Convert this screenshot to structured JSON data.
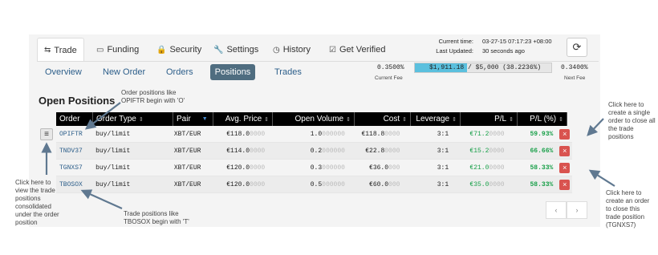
{
  "tabs": [
    {
      "icon": "⇆",
      "label": "Trade"
    },
    {
      "icon": "▭",
      "label": "Funding"
    },
    {
      "icon": "🔒",
      "label": "Security"
    },
    {
      "icon": "🔧",
      "label": "Settings"
    },
    {
      "icon": "◷",
      "label": "History"
    },
    {
      "icon": "☑",
      "label": "Get Verified"
    }
  ],
  "meta": {
    "current_time_label": "Current time:",
    "current_time": "03-27-15 07:17:23 +08:00",
    "last_updated_label": "Last Updated:",
    "last_updated": "30 seconds ago"
  },
  "subnav": [
    "Overview",
    "New Order",
    "Orders",
    "Positions",
    "Trades"
  ],
  "fees": {
    "current_fee": "0.3500%",
    "current_fee_label": "Current Fee",
    "volume": "$1,911.18",
    "volume_rest": " / $5,000 (38.2236%)",
    "progress_pct": 38.2236,
    "next_fee": "0.3400%",
    "next_fee_label": "Next Fee"
  },
  "title": "Open Positions",
  "columns": [
    "Order",
    "Order Type",
    "Pair",
    "Avg. Price",
    "Open Volume",
    "Cost",
    "Leverage",
    "P/L",
    "P/L (%)"
  ],
  "rows": [
    {
      "order": "OPIFTR",
      "type": "buy/limit",
      "pair": "XBT/EUR",
      "price": "€118.0",
      "price_dim": "0000",
      "vol": "1.0",
      "vol_dim": "000000",
      "cost": "€118.8",
      "cost_dim": "0000",
      "lev": "3:1",
      "pl": "€71.2",
      "pl_dim": "0000",
      "plpct": "59.93%"
    },
    {
      "order": "TNDV37",
      "type": "buy/limit",
      "pair": "XBT/EUR",
      "price": "€114.0",
      "price_dim": "0000",
      "vol": "0.2",
      "vol_dim": "000000",
      "cost": "€22.8",
      "cost_dim": "0000",
      "lev": "3:1",
      "pl": "€15.2",
      "pl_dim": "0000",
      "plpct": "66.66%"
    },
    {
      "order": "TGNXS7",
      "type": "buy/limit",
      "pair": "XBT/EUR",
      "price": "€120.0",
      "price_dim": "0000",
      "vol": "0.3",
      "vol_dim": "000000",
      "cost": "€36.0",
      "cost_dim": "000",
      "lev": "3:1",
      "pl": "€21.0",
      "pl_dim": "0000",
      "plpct": "58.33%"
    },
    {
      "order": "TBOSOX",
      "type": "buy/limit",
      "pair": "XBT/EUR",
      "price": "€120.0",
      "price_dim": "0000",
      "vol": "0.5",
      "vol_dim": "000000",
      "cost": "€60.0",
      "cost_dim": "000",
      "lev": "3:1",
      "pl": "€35.0",
      "pl_dim": "0000",
      "plpct": "58.33%"
    }
  ],
  "close_label": "×",
  "pagination": {
    "prev": "‹",
    "next": "›"
  },
  "annotations": {
    "order_o": "Order positions like OPIFTR begin with 'O'",
    "trade_t": "Trade positions like TBOSOX begin with 'T'",
    "view": "Click here to view the trade positions consolidated under the order position",
    "close_all": "Click here to create a single order to close all the trade positions",
    "close_one": "Click here to create an order to close this trade position (TGNXS7)"
  },
  "colors": {
    "accent": "#4f6d80",
    "danger": "#d9534f",
    "positive": "#1aa04a",
    "progress": "#5bc0de"
  }
}
